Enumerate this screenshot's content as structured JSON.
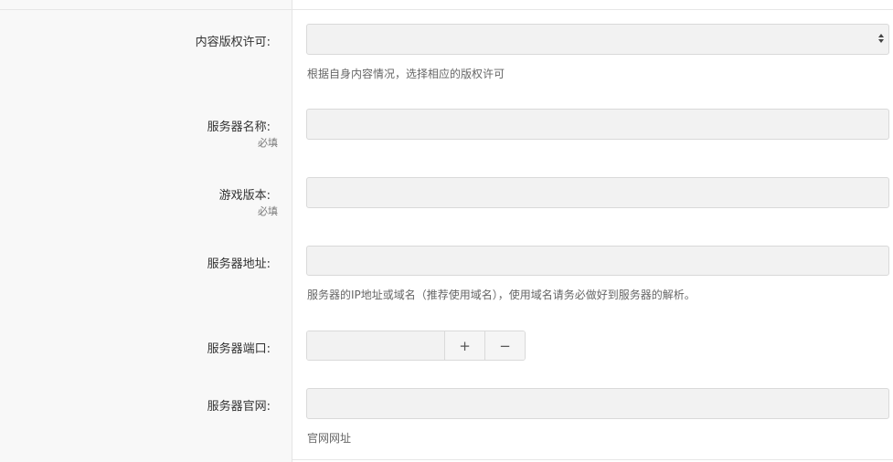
{
  "form": {
    "license": {
      "label": "内容版权许可:",
      "value": "",
      "hint": "根据自身内容情况，选择相应的版权许可"
    },
    "server_name": {
      "label": "服务器名称:",
      "required": "必填",
      "value": ""
    },
    "game_version": {
      "label": "游戏版本:",
      "required": "必填",
      "value": ""
    },
    "server_address": {
      "label": "服务器地址:",
      "value": "",
      "hint": "服务器的IP地址或域名（推荐使用域名），使用域名请务必做好到服务器的解析。"
    },
    "server_port": {
      "label": "服务器端口:",
      "value": "",
      "plus": "+",
      "minus": "−"
    },
    "server_website": {
      "label": "服务器官网:",
      "value": "",
      "hint": "官网网址"
    }
  },
  "icons": {
    "select_arrow": "select-arrows-icon"
  }
}
